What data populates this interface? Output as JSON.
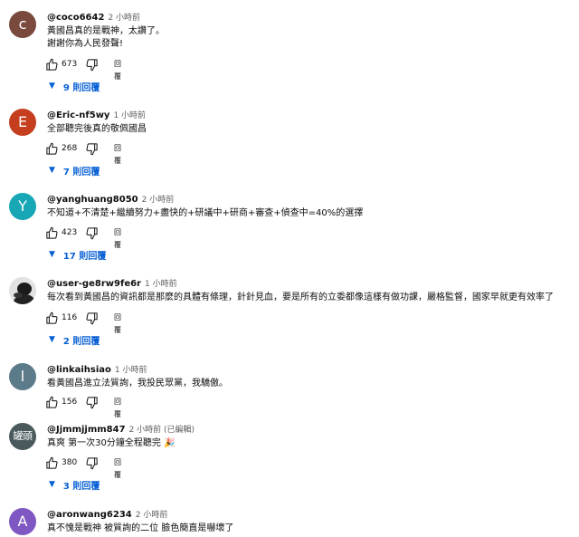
{
  "colors": {
    "avatar_c": "#7a4a3e",
    "avatar_e": "#c53e1e",
    "avatar_y": "#18a7b4",
    "avatar_i": "#5c7b8a",
    "avatar_jj": "#4a5a5c",
    "avatar_a": "#7e57c2",
    "link": "#065fd4"
  },
  "icons": {
    "like": "thumb-up-icon",
    "dislike": "thumb-down-icon",
    "expand": "caret-down-icon"
  },
  "comments": [
    {
      "avatar_letter": "c",
      "handle": "@coco6642",
      "time": "2 小時前",
      "lines": [
        "黃國昌真的是戰神，太讚了。",
        "謝謝你為人民發聲!"
      ],
      "likes": "673",
      "reply_label": "回覆",
      "replies": "9 則回覆"
    },
    {
      "avatar_letter": "E",
      "handle": "@Eric-nf5wy",
      "time": "1 小時前",
      "lines": [
        "全部聽完後真的敬佩國昌"
      ],
      "likes": "268",
      "reply_label": "回覆",
      "replies": "7 則回覆"
    },
    {
      "avatar_letter": "Y",
      "handle": "@yanghuang8050",
      "time": "2 小時前",
      "lines": [
        "不知道+不清楚+繼續努力+盡快的+研議中+研商+審查+偵查中=40%的選擇"
      ],
      "likes": "423",
      "reply_label": "回覆",
      "replies": "17 則回覆"
    },
    {
      "avatar_letter": "",
      "handle": "@user-ge8rw9fe6r",
      "time": "1 小時前",
      "lines": [
        "每次看到黃國昌的資訊都是那麼的具體有條理，針針見血，要是所有的立委都像這樣有做功課，嚴格監督，國家早就更有效率了"
      ],
      "likes": "116",
      "reply_label": "回覆",
      "replies": "2 則回覆"
    },
    {
      "avatar_letter": "l",
      "handle": "@linkaihsiao",
      "time": "1 小時前",
      "lines": [
        "看黃國昌進立法質詢，我投民眾黨，我驕傲。"
      ],
      "likes": "156",
      "reply_label": "回覆",
      "replies": ""
    },
    {
      "avatar_letter": "罐頭",
      "handle": "@Jjmmjjmm847",
      "time": "2 小時前 (已編輯)",
      "lines": [
        "真爽 第一次30分鐘全程聽完 🎉"
      ],
      "likes": "380",
      "reply_label": "回覆",
      "replies": "3 則回覆"
    },
    {
      "avatar_letter": "A",
      "handle": "@aronwang6234",
      "time": "2 小時前",
      "lines": [
        "真不愧是戰神 被質詢的二位 臉色簡直是嚇壞了"
      ],
      "likes": "",
      "reply_label": "",
      "replies": ""
    }
  ]
}
